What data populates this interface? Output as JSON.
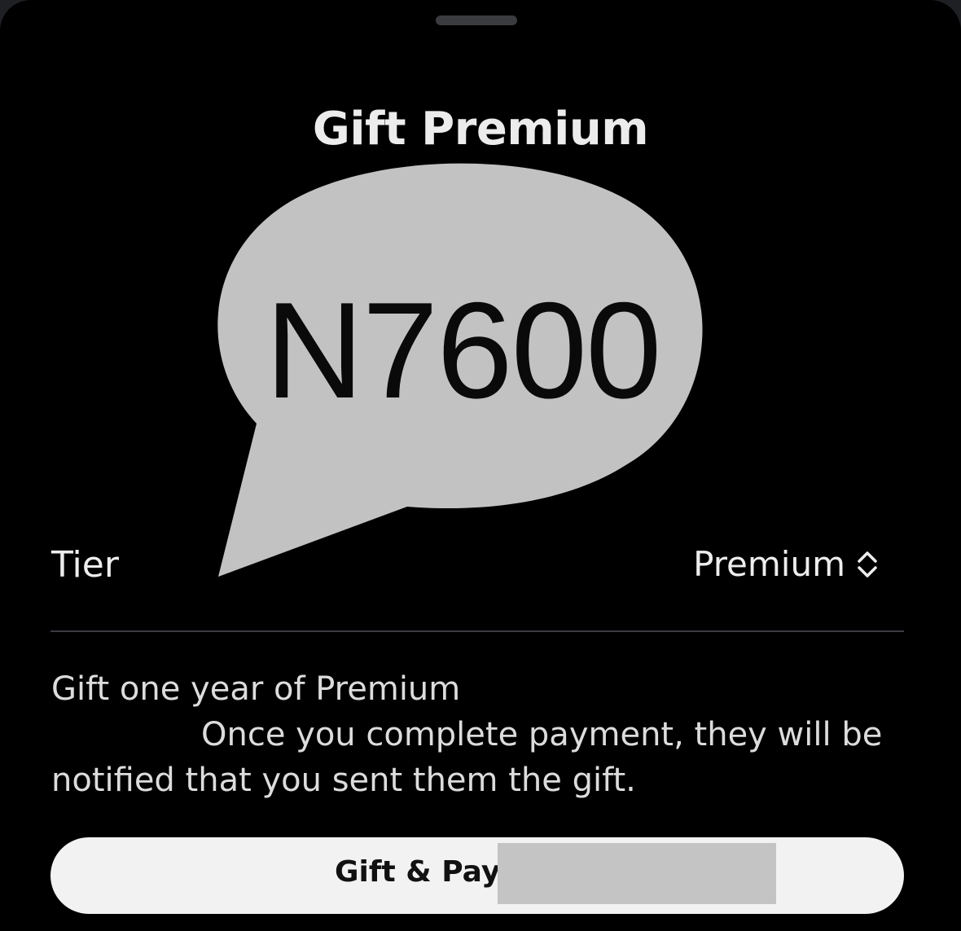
{
  "sheet": {
    "title": "Gift Premium"
  },
  "overlay": {
    "bubble_text": "N7600",
    "bubble_color": "#c2c2c2"
  },
  "tier": {
    "label": "Tier",
    "value": "Premium",
    "icon": "chevron-up-down-icon"
  },
  "description": {
    "line1": "Gift one year of Premium",
    "line2": "Once you complete payment, they will be notified that you sent them the gift."
  },
  "action": {
    "button_label": "Gift & Pay"
  }
}
